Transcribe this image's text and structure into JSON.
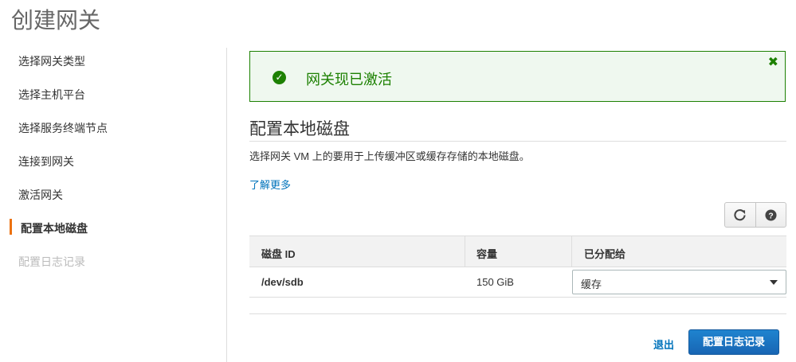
{
  "page": {
    "title": "创建网关"
  },
  "sidebar": {
    "items": [
      {
        "label": "选择网关类型"
      },
      {
        "label": "选择主机平台"
      },
      {
        "label": "选择服务终端节点"
      },
      {
        "label": "连接到网关"
      },
      {
        "label": "激活网关"
      },
      {
        "label": "配置本地磁盘",
        "state": "active"
      },
      {
        "label": "配置日志记录",
        "state": "disabled"
      }
    ]
  },
  "alert": {
    "message": "网关现已激活",
    "icon": "check-circle-icon",
    "close_icon": "close-icon",
    "color": "#1d8102"
  },
  "section": {
    "title": "配置本地磁盘",
    "description": "选择网关 VM 上的要用于上传缓冲区或缓存存储的本地磁盘。",
    "learn_more": "了解更多"
  },
  "toolbar": {
    "refresh_icon": "refresh-icon",
    "help_icon": "help-icon"
  },
  "table": {
    "headers": [
      "磁盘 ID",
      "容量",
      "已分配给"
    ],
    "rows": [
      {
        "disk_id": "/dev/sdb",
        "capacity": "150 GiB",
        "allocated_to": "缓存"
      }
    ]
  },
  "footer": {
    "exit_label": "退出",
    "next_label": "配置日志记录"
  },
  "colors": {
    "accent": "#ec7211",
    "link": "#0073bb",
    "primary": "#1f7bc8"
  }
}
